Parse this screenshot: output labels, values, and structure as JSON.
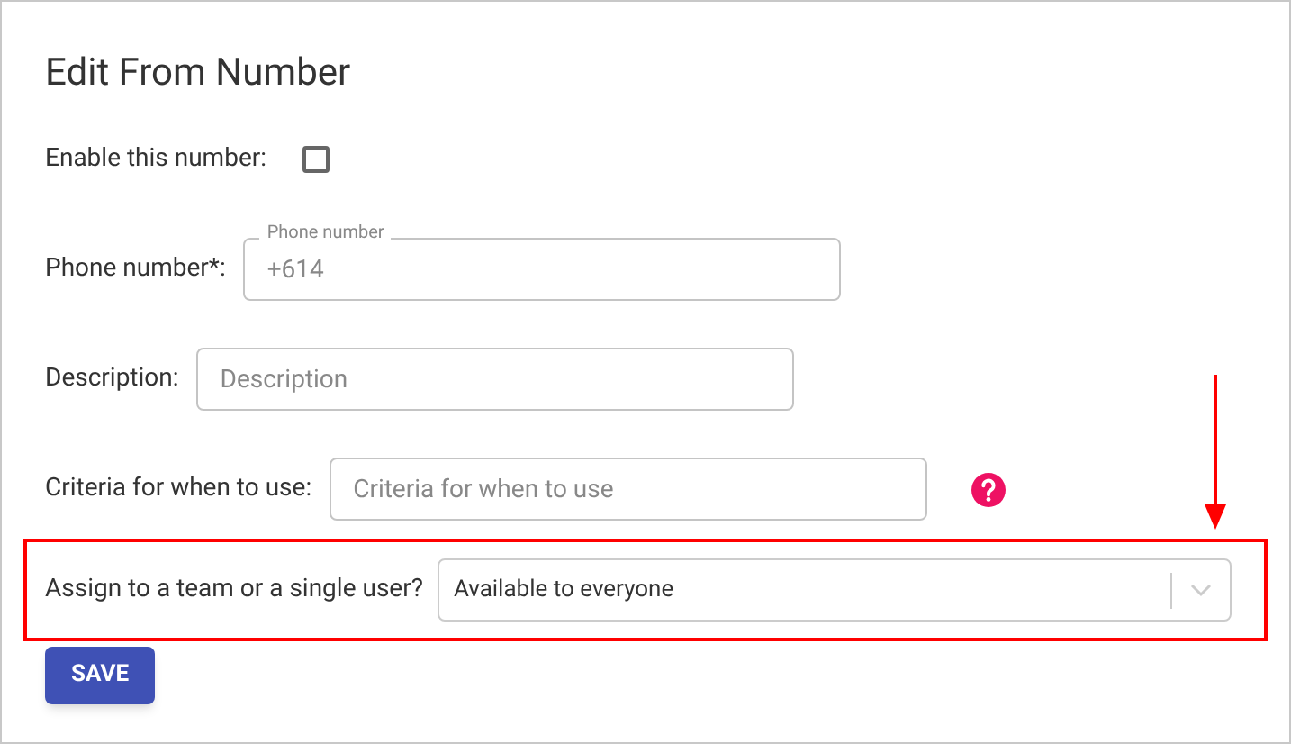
{
  "title": "Edit From Number",
  "fields": [
    {
      "kind": "checkbox",
      "label": "Enable this number:",
      "checked": false
    },
    {
      "kind": "outlined",
      "label": "Phone number*:",
      "floating_label": "Phone number",
      "value": "+614"
    },
    {
      "kind": "text",
      "label": "Description:",
      "placeholder": "Description"
    },
    {
      "kind": "text",
      "label": "Criteria for when to use:",
      "placeholder": "Criteria for when to use",
      "help": true
    },
    {
      "kind": "select",
      "label": "Assign to a team or a single user?",
      "value": "Available to everyone",
      "highlighted": true
    }
  ],
  "save_button": "SAVE"
}
